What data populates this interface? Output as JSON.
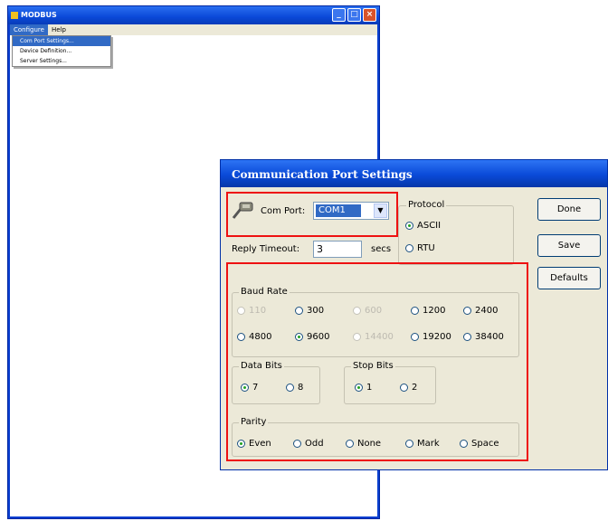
{
  "main_window": {
    "title": "MODBUS",
    "menus": [
      "Configure",
      "Help"
    ],
    "dropdown_items": [
      "Com Port Settings...",
      "Device Definition...",
      "Server Settings..."
    ]
  },
  "dialog": {
    "title": "Communication Port Settings",
    "com_port_label": "Com Port:",
    "com_port_value": "COM1",
    "reply_timeout_label": "Reply Timeout:",
    "reply_timeout_value": "3",
    "reply_timeout_unit": "secs",
    "protocol": {
      "label": "Protocol",
      "options": [
        {
          "label": "ASCII",
          "selected": true
        },
        {
          "label": "RTU",
          "selected": false
        }
      ]
    },
    "buttons": {
      "done": "Done",
      "save": "Save",
      "defaults": "Defaults"
    },
    "baud_rate": {
      "label": "Baud Rate",
      "options": [
        {
          "label": "110",
          "selected": false,
          "enabled": false
        },
        {
          "label": "300",
          "selected": false,
          "enabled": true
        },
        {
          "label": "600",
          "selected": false,
          "enabled": false
        },
        {
          "label": "1200",
          "selected": false,
          "enabled": true
        },
        {
          "label": "2400",
          "selected": false,
          "enabled": true
        },
        {
          "label": "4800",
          "selected": false,
          "enabled": true
        },
        {
          "label": "9600",
          "selected": true,
          "enabled": true
        },
        {
          "label": "14400",
          "selected": false,
          "enabled": false
        },
        {
          "label": "19200",
          "selected": false,
          "enabled": true
        },
        {
          "label": "38400",
          "selected": false,
          "enabled": true
        }
      ]
    },
    "data_bits": {
      "label": "Data Bits",
      "options": [
        {
          "label": "7",
          "selected": true
        },
        {
          "label": "8",
          "selected": false
        }
      ]
    },
    "stop_bits": {
      "label": "Stop Bits",
      "options": [
        {
          "label": "1",
          "selected": true
        },
        {
          "label": "2",
          "selected": false
        }
      ]
    },
    "parity": {
      "label": "Parity",
      "options": [
        {
          "label": "Even",
          "selected": true
        },
        {
          "label": "Odd",
          "selected": false
        },
        {
          "label": "None",
          "selected": false
        },
        {
          "label": "Mark",
          "selected": false
        },
        {
          "label": "Space",
          "selected": false
        }
      ]
    }
  },
  "colors": {
    "highlight": "#ee1111",
    "title_bar": "#0a48d8",
    "dialog_bg": "#ece9d8"
  }
}
